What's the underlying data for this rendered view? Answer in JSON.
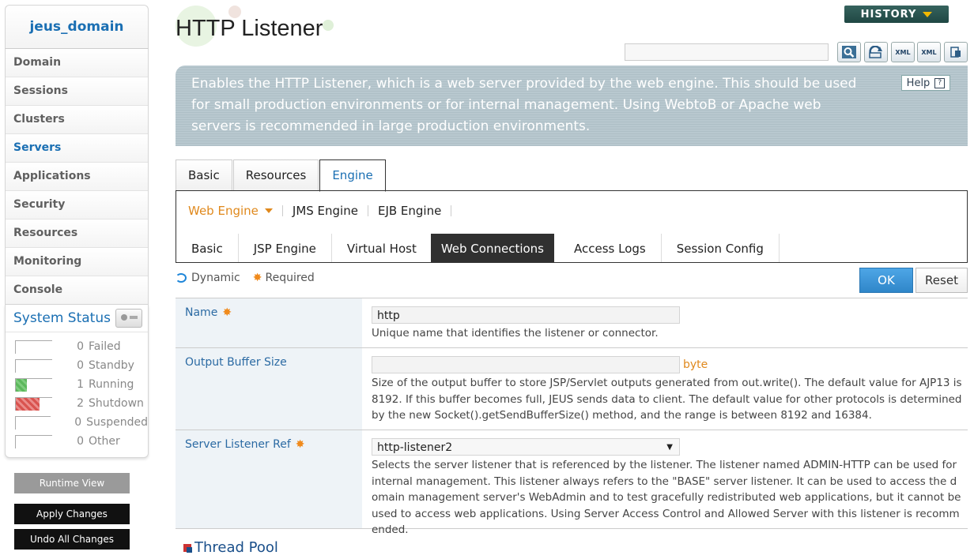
{
  "sidebar": {
    "domain": "jeus_domain",
    "nav": [
      "Domain",
      "Sessions",
      "Clusters",
      "Servers",
      "Applications",
      "Security",
      "Resources",
      "Monitoring",
      "Console"
    ],
    "active": "Servers",
    "system_status_title": "System Status",
    "status": [
      {
        "count": "0",
        "label": "Failed"
      },
      {
        "count": "0",
        "label": "Standby"
      },
      {
        "count": "1",
        "label": "Running"
      },
      {
        "count": "2",
        "label": "Shutdown"
      },
      {
        "count": "0",
        "label": "Suspended"
      },
      {
        "count": "0",
        "label": "Other"
      }
    ],
    "runtime_view": "Runtime View",
    "apply_changes": "Apply Changes",
    "undo_all_changes": "Undo All Changes"
  },
  "header": {
    "title": "HTTP Listener",
    "history": "HISTORY",
    "tool_icons": [
      "search-icon",
      "refresh-icon",
      "xml-export-icon",
      "xml-import-icon",
      "config-icon"
    ]
  },
  "description": {
    "text": "Enables the HTTP Listener, which is a web server provided by the web engine. This should be used for small production environments or for internal management. Using WebtoB or Apache web servers is recommended in large production environments.",
    "help": "Help",
    "help_icon": "?"
  },
  "tabs": {
    "main": [
      "Basic",
      "Resources",
      "Engine"
    ],
    "main_active": "Engine",
    "engine": [
      "Web Engine",
      "JMS Engine",
      "EJB Engine"
    ],
    "engine_active": "Web Engine",
    "web": [
      "Basic",
      "JSP Engine",
      "Virtual Host",
      "Web Connections",
      "Access Logs",
      "Session Config"
    ],
    "web_active": "Web Connections"
  },
  "legend": {
    "dynamic": "Dynamic",
    "required": "Required"
  },
  "actions": {
    "ok": "OK",
    "reset": "Reset"
  },
  "form": {
    "name": {
      "label": "Name",
      "value": "http",
      "help": "Unique name that identifies the listener or connector."
    },
    "output_buffer": {
      "label": "Output Buffer Size",
      "value": "",
      "unit": "byte",
      "help": "Size of the output buffer to store JSP/Servlet outputs generated from out.write(). The default value for AJP13 is 8192. If this buffer becomes full, JEUS sends data to client. The default value for other protocols is determined by the new Socket().getSendBufferSize() method, and the range is between 8192 and 16384."
    },
    "server_listener_ref": {
      "label": "Server Listener Ref",
      "value": "http-listener2",
      "help": "Selects the server listener that is referenced by the listener. The listener named ADMIN-HTTP can be used for internal management. This listener always refers to the \"BASE\" server listener. It can be used to access the domain management server's WebAdmin and to test gracefully redistributed web applications, but it cannot be used to access web applications. Using Server Access Control and Allowed Server with this listener is recommended."
    }
  },
  "section": {
    "thread_pool": "Thread Pool"
  }
}
